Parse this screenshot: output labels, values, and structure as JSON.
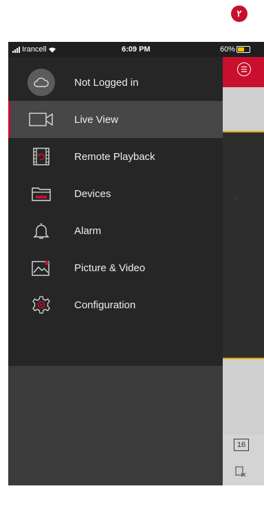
{
  "badge": "٢",
  "status_bar": {
    "carrier": "Irancell",
    "time": "6:09 PM",
    "battery": "60%"
  },
  "side_panel": {
    "toolbar": {
      "channels_label": "16"
    }
  },
  "drawer": {
    "items": [
      {
        "label": "Not Logged in",
        "icon": "cloud-icon",
        "active": false
      },
      {
        "label": "Live View",
        "icon": "video-camera-icon",
        "active": true
      },
      {
        "label": "Remote Playback",
        "icon": "playback-icon",
        "active": false
      },
      {
        "label": "Devices",
        "icon": "device-icon",
        "active": false
      },
      {
        "label": "Alarm",
        "icon": "bell-icon",
        "active": false
      },
      {
        "label": "Picture & Video",
        "icon": "picture-icon",
        "active": false
      },
      {
        "label": "Configuration",
        "icon": "gear-icon",
        "active": false
      }
    ]
  },
  "colors": {
    "accent": "#c8102e",
    "drawer_bg": "#262626",
    "active_item_bg": "#474747",
    "highlight_line": "#e0a400"
  }
}
